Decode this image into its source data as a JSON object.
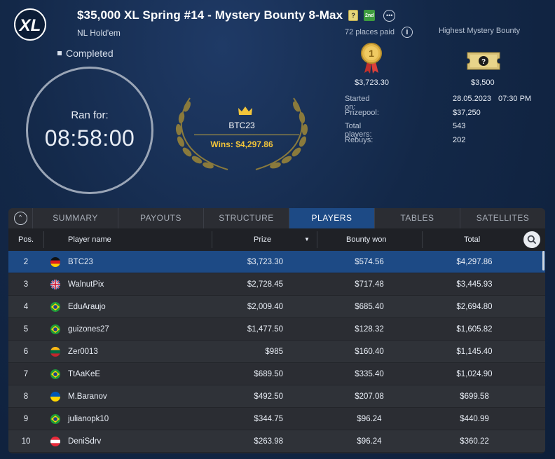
{
  "header": {
    "logo_text": "XL",
    "title": "$35,000 XL Spring #14 - Mystery Bounty 8-Max",
    "tag_question": "?",
    "tag_new": "2nd",
    "more_icon": "ellipsis-icon",
    "game_type": "NL Hold'em",
    "status": "Completed",
    "places_paid": "72 places paid",
    "highest_bounty_label": "Highest Mystery Bounty"
  },
  "clock": {
    "label": "Ran for:",
    "time": "08:58:00"
  },
  "winner": {
    "name": "BTC23",
    "wins": "Wins: $4,297.86"
  },
  "prizes": {
    "first_medal_number": "1",
    "first_prize": "$3,723.30",
    "mystery_bounty": "$3,500"
  },
  "info": {
    "started_label": "Started on:",
    "started_date": "28.05.2023",
    "started_time": "07:30 PM",
    "prizepool_label": "Prizepool:",
    "prizepool": "$37,250",
    "players_label": "Total players:",
    "players": "543",
    "rebuys_label": "Rebuys:",
    "rebuys": "202"
  },
  "tabs": [
    "SUMMARY",
    "PAYOUTS",
    "STRUCTURE",
    "PLAYERS",
    "TABLES",
    "SATELLITES"
  ],
  "active_tab": "PLAYERS",
  "table": {
    "headers": {
      "pos": "Pos.",
      "name": "Player name",
      "prize": "Prize",
      "bounty": "Bounty won",
      "total": "Total"
    },
    "rows": [
      {
        "pos": "2",
        "flag": "de",
        "name": "BTC23",
        "prize": "$3,723.30",
        "bounty": "$574.56",
        "total": "$4,297.86"
      },
      {
        "pos": "3",
        "flag": "gb",
        "name": "WalnutPix",
        "prize": "$2,728.45",
        "bounty": "$717.48",
        "total": "$3,445.93"
      },
      {
        "pos": "4",
        "flag": "br",
        "name": "EduAraujo",
        "prize": "$2,009.40",
        "bounty": "$685.40",
        "total": "$2,694.80"
      },
      {
        "pos": "5",
        "flag": "br",
        "name": "guizones27",
        "prize": "$1,477.50",
        "bounty": "$128.32",
        "total": "$1,605.82"
      },
      {
        "pos": "6",
        "flag": "lt",
        "name": "Zer0013",
        "prize": "$985",
        "bounty": "$160.40",
        "total": "$1,145.40"
      },
      {
        "pos": "7",
        "flag": "br",
        "name": "TtAaKeE",
        "prize": "$689.50",
        "bounty": "$335.40",
        "total": "$1,024.90"
      },
      {
        "pos": "8",
        "flag": "ua",
        "name": "M.Baranov",
        "prize": "$492.50",
        "bounty": "$207.08",
        "total": "$699.58"
      },
      {
        "pos": "9",
        "flag": "br",
        "name": "julianopk10",
        "prize": "$344.75",
        "bounty": "$96.24",
        "total": "$440.99"
      },
      {
        "pos": "10",
        "flag": "at",
        "name": "DeniSdrv",
        "prize": "$263.98",
        "bounty": "$96.24",
        "total": "$360.22"
      }
    ]
  },
  "colors": {
    "accent": "#1d4a85",
    "gold": "#f2c43a",
    "background": "#132848",
    "panel": "#2b2d33"
  }
}
